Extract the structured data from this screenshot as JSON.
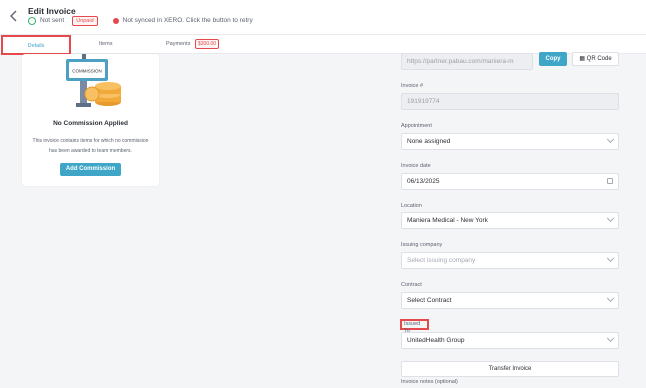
{
  "header": {
    "title": "Edit Invoice",
    "send_status": "Not sent",
    "payment_badge": "Unpaid",
    "xero_status": "Not synced in XERO. Click the button to retry"
  },
  "tabs": {
    "details": "Details",
    "items": "Items",
    "payments": "Payments",
    "payments_badge": "$300.00"
  },
  "commission": {
    "sign_text": "COMMISSION",
    "title": "No Commission Applied",
    "description": "This invoice contains items for which no commission has been awarded to team members.",
    "button": "Add Commission"
  },
  "form": {
    "url_value": "https://partner.pabau.com/maniera-m",
    "copy_label": "Copy",
    "qr_label": "QR Code",
    "invoice_no_label": "Invoice #",
    "invoice_no_value": "191919774",
    "appointment_label": "Appointment",
    "appointment_value": "None assigned",
    "invoice_date_label": "Invoice date",
    "invoice_date_value": "06/13/2025",
    "location_label": "Location",
    "location_value": "Maniera Medical - New York",
    "issuing_company_label": "Issuing company",
    "issuing_company_placeholder": "Select issuing company",
    "contract_label": "Contract",
    "contract_value": "Select Contract",
    "issued_to_label": "Issued To",
    "issued_to_value": "UnitedHealth Group",
    "transfer_label": "Transfer Invoice",
    "notes_label": "Invoice notes (optional)"
  },
  "colors": {
    "accent": "#3fa6c8",
    "danger": "#e5484d",
    "success": "#34b76a"
  }
}
